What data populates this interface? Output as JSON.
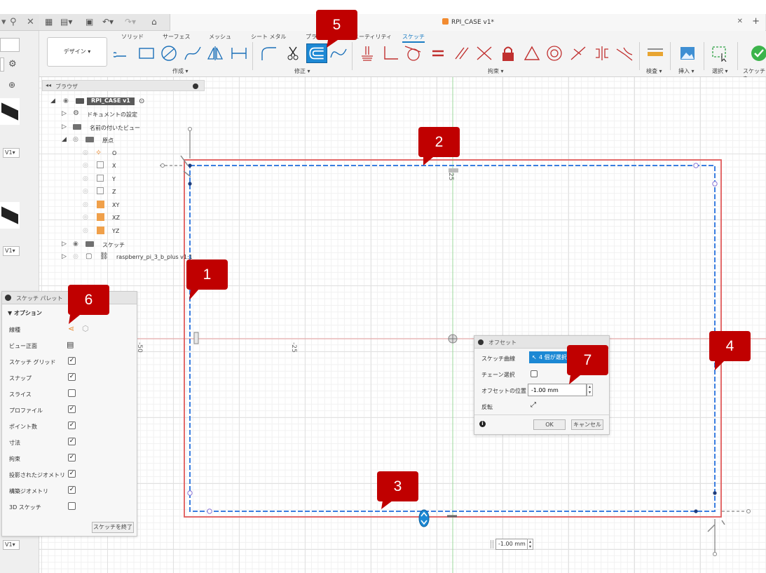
{
  "window": {
    "title": "RPI_CASE v1*"
  },
  "ribbon": {
    "tabs": [
      "ソリッド",
      "サーフェス",
      "メッシュ",
      "シート メタル",
      "プラス",
      "ユーティリティ",
      "スケッチ"
    ],
    "active_tab": "スケッチ",
    "design_button": "デザイン ▾",
    "groups": {
      "create": "作成 ▾",
      "modify": "修正 ▾",
      "constraints": "拘束 ▾",
      "inspect": "検査 ▾",
      "insert": "挿入 ▾",
      "select": "選択 ▾",
      "finish": "スケッチを"
    }
  },
  "browser": {
    "title": "ブラウザ",
    "root": "RPI_CASE v1",
    "items": {
      "doc_settings": "ドキュメントの設定",
      "named_views": "名前の付いたビュー",
      "origin": "原点",
      "o": "O",
      "x": "X",
      "y": "Y",
      "z": "Z",
      "xy": "XY",
      "xz": "XZ",
      "yz": "YZ",
      "sketches": "スケッチ",
      "component": "raspberry_pi_3_b_plus v1:1"
    }
  },
  "palette": {
    "title": "スケッチ パレット",
    "section": "オプション",
    "rows": [
      {
        "label": "線種"
      },
      {
        "label": "ビュー正面"
      },
      {
        "label": "スケッチ グリッド",
        "checked": "✓"
      },
      {
        "label": "スナップ",
        "checked": "✓"
      },
      {
        "label": "スライス",
        "checked": ""
      },
      {
        "label": "プロファイル",
        "checked": "✓"
      },
      {
        "label": "ポイント数",
        "checked": "✓"
      },
      {
        "label": "寸法",
        "checked": "✓"
      },
      {
        "label": "拘束",
        "checked": "✓"
      },
      {
        "label": "投影されたジオメトリ",
        "checked": "✓"
      },
      {
        "label": "構築ジオメトリ",
        "checked": "✓"
      },
      {
        "label": "3D スケッチ",
        "checked": ""
      }
    ],
    "finish": "スケッチを終了"
  },
  "offset_dialog": {
    "title": "オフセット",
    "curve_label": "スケッチ曲線",
    "curve_value": "4 個が選択",
    "chain_label": "チェーン選択",
    "position_label": "オフセットの位置",
    "position_value": "-1.00 mm",
    "flip_label": "反転",
    "ok": "OK",
    "cancel": "キャンセル"
  },
  "canvas": {
    "floating_value": "-1.00 mm",
    "dim_25_top": "25",
    "dim_50_left": "-50",
    "dim_25_left": "-25"
  },
  "library": {
    "version": "V1▾"
  },
  "callouts": [
    "1",
    "2",
    "3",
    "4",
    "5",
    "6",
    "7"
  ],
  "colors": {
    "accent": "#1c88d4",
    "callout": "#c00000",
    "sketch_red": "#e06060",
    "sketch_blue": "#3a7ee0"
  }
}
